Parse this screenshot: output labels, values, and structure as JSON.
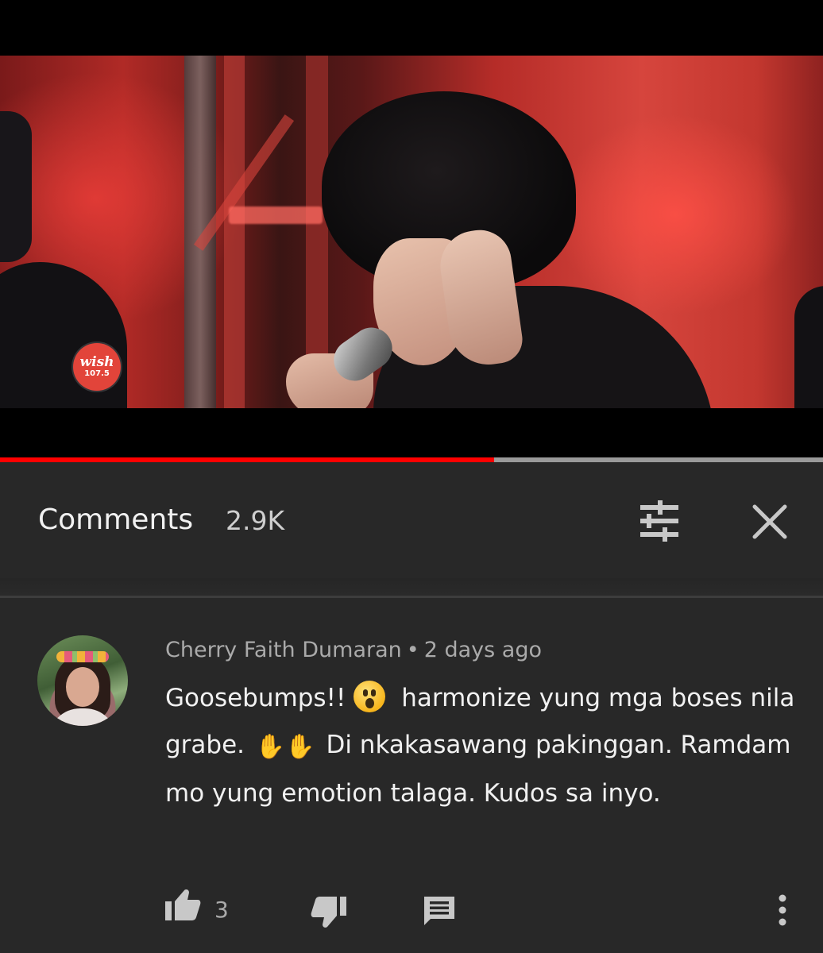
{
  "player": {
    "logo": {
      "line1": "wish",
      "line2": "107.5"
    },
    "progress_fraction": 0.6
  },
  "comments": {
    "title": "Comments",
    "count": "2.9K",
    "sort_icon": "sort-sliders-icon",
    "close_icon": "close-icon"
  },
  "comment": {
    "author": "Cherry Faith Dumaran",
    "separator": "•",
    "time": "2 days ago",
    "text_part1": "Goosebumps!!",
    "text_part2": "harmonize yung mga boses nila grabe.",
    "text_part3": "Di nkakasawang pakinggan. Ramdam mo yung emotion talaga. Kudos sa inyo.",
    "like_count": "3",
    "icons": {
      "like": "thumbs-up-icon",
      "dislike": "thumbs-down-icon",
      "reply": "reply-comment-icon",
      "more": "more-vert-icon"
    }
  },
  "colors": {
    "background": "#282828",
    "progress": "#ff0000",
    "text_primary": "#f1f1f1",
    "text_secondary": "#aaaaaa"
  }
}
